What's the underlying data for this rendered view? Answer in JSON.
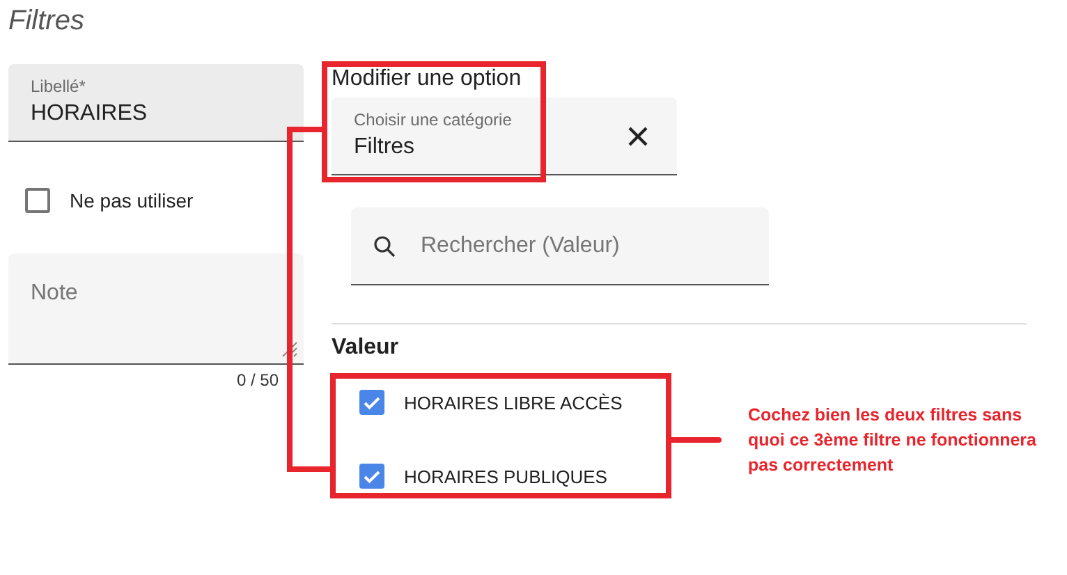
{
  "page_title": "Filtres",
  "libelle": {
    "label": "Libellé*",
    "value": "HORAIRES"
  },
  "ne_pas_utiliser": {
    "label": "Ne pas utiliser",
    "checked": false
  },
  "note": {
    "placeholder": "Note",
    "counter": "0 / 50"
  },
  "option": {
    "heading": "Modifier une option",
    "category_label": "Choisir une catégorie",
    "category_value": "Filtres"
  },
  "search": {
    "placeholder": "Rechercher (Valeur)"
  },
  "values": {
    "heading": "Valeur",
    "items": [
      {
        "label": "HORAIRES LIBRE ACCÈS",
        "checked": true
      },
      {
        "label": "HORAIRES PUBLIQUES",
        "checked": true
      }
    ]
  },
  "annotation": {
    "text": "Cochez bien les deux filtres sans quoi ce 3ème filtre ne fonctionnera pas correctement"
  }
}
